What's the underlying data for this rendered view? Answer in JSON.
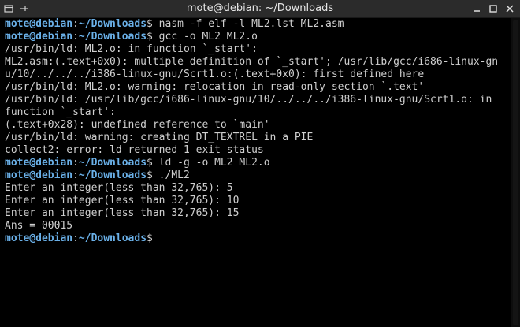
{
  "window": {
    "title": "mote@debian: ~/Downloads"
  },
  "titlebar_icons": {
    "left": [
      "window-menu-icon",
      "pin-icon"
    ],
    "right": [
      "minimize-icon",
      "maximize-icon",
      "close-icon"
    ]
  },
  "prompt": {
    "user_host": "mote@debian",
    "separator": ":",
    "path": "~/Downloads",
    "symbol": "$"
  },
  "terminal": {
    "lines": [
      {
        "type": "prompt",
        "cmd": " nasm -f elf -l ML2.lst ML2.asm"
      },
      {
        "type": "prompt",
        "cmd": " gcc -o ML2 ML2.o"
      },
      {
        "type": "output",
        "text": "/usr/bin/ld: ML2.o: in function `_start':"
      },
      {
        "type": "output",
        "text": "ML2.asm:(.text+0x0): multiple definition of `_start'; /usr/lib/gcc/i686-linux-gn"
      },
      {
        "type": "output",
        "text": "u/10/../../../i386-linux-gnu/Scrt1.o:(.text+0x0): first defined here"
      },
      {
        "type": "output",
        "text": "/usr/bin/ld: ML2.o: warning: relocation in read-only section `.text'"
      },
      {
        "type": "output",
        "text": "/usr/bin/ld: /usr/lib/gcc/i686-linux-gnu/10/../../../i386-linux-gnu/Scrt1.o: in"
      },
      {
        "type": "output",
        "text": "function `_start':"
      },
      {
        "type": "output",
        "text": "(.text+0x28): undefined reference to `main'"
      },
      {
        "type": "output",
        "text": "/usr/bin/ld: warning: creating DT_TEXTREL in a PIE"
      },
      {
        "type": "output",
        "text": "collect2: error: ld returned 1 exit status"
      },
      {
        "type": "prompt",
        "cmd": " ld -g -o ML2 ML2.o"
      },
      {
        "type": "prompt",
        "cmd": " ./ML2"
      },
      {
        "type": "output",
        "text": "Enter an integer(less than 32,765): 5"
      },
      {
        "type": "output",
        "text": "Enter an integer(less than 32,765): 10"
      },
      {
        "type": "output",
        "text": "Enter an integer(less than 32,765): 15"
      },
      {
        "type": "output",
        "text": "Ans = 00015"
      },
      {
        "type": "prompt",
        "cmd": ""
      }
    ]
  },
  "colors": {
    "background": "#000000",
    "text": "#cfcfcf",
    "prompt": "#6ab0e8",
    "titlebar": "#2b2b2b"
  }
}
